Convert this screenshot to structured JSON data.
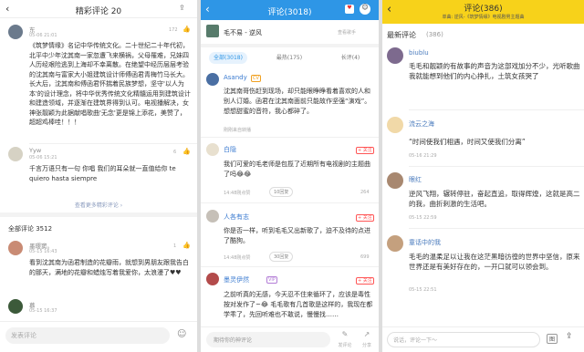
{
  "p1": {
    "title": "精彩评论 20",
    "c1": {
      "user": "东",
      "date": "05-06 21:01",
      "likes": "172",
      "text": "《筑梦情缘》名记中华传统文化。二十世纪二十年代初，北平中少年沈其南一家忽遭飞来横祸，父母罹难，兄妹四人历经艰险逃到上海却不幸离散。在绝望中经历层层考验的沈其南与富家大小姐建筑设计师傅函君青梅竹马长大。长大后，沈其南和傅函君怀揣着民族梦想，坚守'以人为本'的设计理念，将中华优秀传统文化精髓运用到建筑设计和建造领域，并逐渐在建筑界得到认可。电视播解决，女神张靓颖为此据献唱歌曲'无念'更是锦上添花，美赞了，超超鸡棒哇！！！"
    },
    "c2": {
      "user": "Yyw",
      "date": "05-06 15:21",
      "likes": "6",
      "text": "千言万语只有一句 你唱 我们的耳朵就一直值给你 te quiero hasta siempre"
    },
    "more": "查看更多精彩评论 ›",
    "all": "全部评论 3512",
    "c3": {
      "user": "墨璎窦。",
      "date": "05-15 16:43",
      "likes": "1",
      "text": "看到沈其南为函君制造的花瓣雨，就想到男朋友跟我告白的那天，满地的花瓣和蜡烛写着我爱你，太浪漫了♥♥"
    },
    "c4": {
      "user": "慕",
      "date": "05-15 16:37"
    },
    "input": "发表评论"
  },
  "p2": {
    "title": "评论(3018)",
    "song": "毛不易 - 逆风",
    "meta": "查看歌手",
    "tabs": [
      "全部(3018)",
      "最热(175)",
      "长评(4)"
    ],
    "c1": {
      "user": "Asandy",
      "badge": "CV",
      "text": "沈其南哥伤赶到现场，却只能眼睁睁看着喜欢的人和别人订婚。函君在沈其南面前只能故作坚强“演戏”。想想甜蜜的音符，我心都碎了。",
      "footer": "刚刚来自转播"
    },
    "c2": {
      "user": "白隐",
      "follow": "+ 关注",
      "text": "我们可爱的毛老师是包揽了近期所有电视剧的主题曲了吗😂😂",
      "time": "14:48刚点赞",
      "count": "10回复",
      "likes": "264"
    },
    "c3": {
      "user": "人各有志",
      "follow": "+ 关注",
      "text": "你是否一样，听到毛毛又出新歌了，迫不及待的点进了酷狗。",
      "time": "14:48刚点赞",
      "count": "30回复",
      "likes": "699"
    },
    "c4": {
      "user": "墨灵伊然",
      "badge": "VIP",
      "follow": "+ 关注",
      "text": "之前听真的无感，今天忍不住来循环了，应该是毒性按对发作了~😂 毛毛歌有几首歌是这样的，我现在都学乖了，先回听难也不敢说，慢慢找……"
    },
    "input": "期待你的神评论",
    "b1": "发评论",
    "b2": "分享"
  },
  "p3": {
    "title": "评论(386)",
    "banner": "单曲: 逆风-《筑梦情缘》电视剧男主题曲",
    "latest": "最新评论",
    "count": "(386)",
    "c1": {
      "user": "biublu",
      "text": "毛毛和靓颖的有故事的声音为这部戏加分不少，光听歌曲我就能想到他们的内心挣扎，土筑女孩哭了"
    },
    "c2": {
      "user": "流云之海",
      "text": "“时间使我们相遇，时间又使我们分离”",
      "date": "05-16 21:29"
    },
    "c3": {
      "user": "眼红",
      "text": "逆风飞翔，辗转停驻，奋起直追，取得辉煌，这就是高二的我，曲折刺激的生活吧。",
      "date": "05-15 22:59"
    },
    "c4": {
      "user": "童话中的我",
      "text": "毛毛的温柔足以让我在这茫黑暗彷徨的世界中坚信，原来世界还是有美好存在的，一开口就可以领会到。",
      "date": "05-15 22:51"
    },
    "input": "说话，评论一下～",
    "b1": "图",
    "b2": "分享"
  }
}
